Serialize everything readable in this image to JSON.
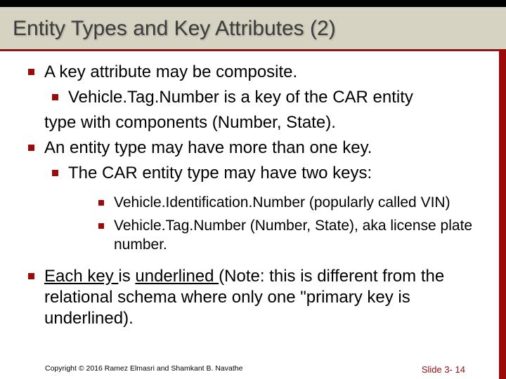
{
  "title": "Entity Types and Key Attributes (2)",
  "bullets": {
    "b1": "A key attribute may be composite.",
    "b1_1a": "Vehicle.Tag.Number is a key of the CAR entity",
    "b1_1b": "type with components (Number, State).",
    "b2": "An entity type may have more than one key.",
    "b2_1": "The CAR entity type may have two keys:",
    "b2_1_1": "Vehicle.Identification.Number (popularly called VIN)",
    "b2_1_2": "Vehicle.Tag.Number (Number, State), aka license plate number.",
    "b3_pre": "Each key ",
    "b3_mid1": "is ",
    "b3_mid2": "underlined ",
    "b3_post": "(Note: this is different from the relational schema where only one \"primary key is underlined)."
  },
  "footer": {
    "copyright": "Copyright © 2016 Ramez Elmasri and Shamkant B. Navathe",
    "slide": "Slide 3- 14"
  }
}
